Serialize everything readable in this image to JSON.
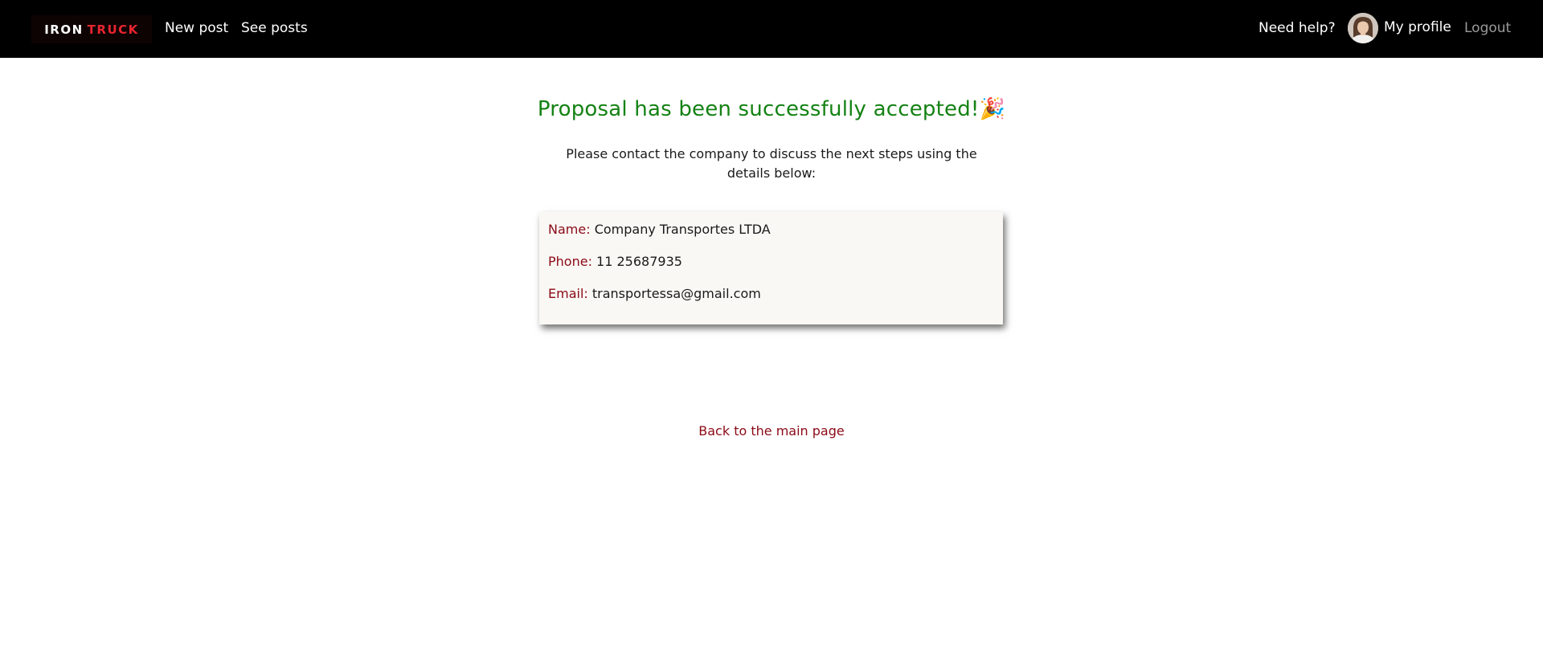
{
  "navbar": {
    "logo": {
      "part1": "IRON",
      "part2": "TRUCK"
    },
    "new_post": "New post",
    "see_posts": "See posts",
    "need_help": "Need help?",
    "my_profile": "My profile",
    "logout": "Logout"
  },
  "main": {
    "title": "Proposal has been successfully accepted!",
    "title_emoji": "🎉",
    "subtitle_line1": "Please contact the company to discuss the next steps using the",
    "subtitle_line2": "details below:",
    "contact": {
      "name_label": "Name:",
      "name_value": "Company Transportes LTDA",
      "phone_label": "Phone:",
      "phone_value": "11 25687935",
      "email_label": "Email:",
      "email_value": "transportessa@gmail.com"
    },
    "back_link": "Back to the main page"
  },
  "colors": {
    "navbar_bg": "#000000",
    "success_title": "#148214",
    "accent_red": "#8b0a16",
    "logo_red": "#e8242f",
    "logout_gray": "#9a9a9a",
    "card_bg": "#f9f8f5"
  },
  "icons": {
    "avatar": "user-avatar",
    "celebration": "party-popper-icon"
  }
}
